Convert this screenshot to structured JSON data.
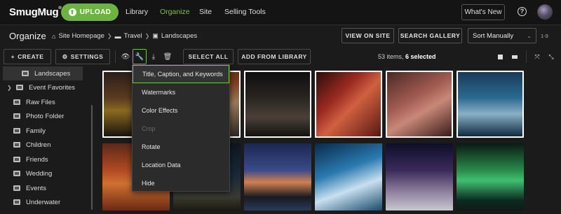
{
  "topbar": {
    "logo": "SmugMug",
    "upload_label": "UPLOAD",
    "nav": [
      "Library",
      "Organize",
      "Site",
      "Selling Tools"
    ],
    "active_nav": "Organize",
    "whats_new": "What's New",
    "help_glyph": "?"
  },
  "header": {
    "title": "Organize",
    "breadcrumb": [
      "Site Homepage",
      "Travel",
      "Landscapes"
    ],
    "view_on_site": "VIEW ON SITE",
    "search_gallery": "SEARCH GALLERY",
    "sort_value": "Sort Manually",
    "range": "1-9"
  },
  "toolbar": {
    "create": "CREATE",
    "settings": "SETTINGS",
    "select_all": "SELECT ALL",
    "add_from_library": "ADD FROM LIBRARY",
    "items_count": "53 items, ",
    "selected_count": "6 selected"
  },
  "sidebar": {
    "items": [
      {
        "label": "Landscapes",
        "selected": true
      },
      {
        "label": "Event Favorites",
        "expandable": true
      },
      {
        "label": "Raw Files"
      },
      {
        "label": "Photo Folder"
      },
      {
        "label": "Family"
      },
      {
        "label": "Children"
      },
      {
        "label": "Friends"
      },
      {
        "label": "Wedding"
      },
      {
        "label": "Events"
      },
      {
        "label": "Underwater"
      }
    ]
  },
  "menu": {
    "items": [
      {
        "label": "Title, Caption, and Keywords",
        "state": "highlighted"
      },
      {
        "label": "Watermarks",
        "state": "normal"
      },
      {
        "label": "Color Effects",
        "state": "normal"
      },
      {
        "label": "Crop",
        "state": "disabled"
      },
      {
        "label": "Rotate",
        "state": "normal"
      },
      {
        "label": "Location Data",
        "state": "normal"
      },
      {
        "label": "Hide",
        "state": "normal"
      }
    ]
  },
  "colors": {
    "accent": "#6db33f",
    "accent_text": "#7cc04a",
    "background": "#1b1b1b"
  },
  "icons": [
    "eye-icon",
    "wrench-icon",
    "download-icon",
    "trash-icon",
    "plus-icon",
    "gear-icon",
    "home-icon",
    "folder-icon",
    "grid-view-icon",
    "list-view-icon",
    "fullscreen-icon",
    "shrink-icon"
  ]
}
